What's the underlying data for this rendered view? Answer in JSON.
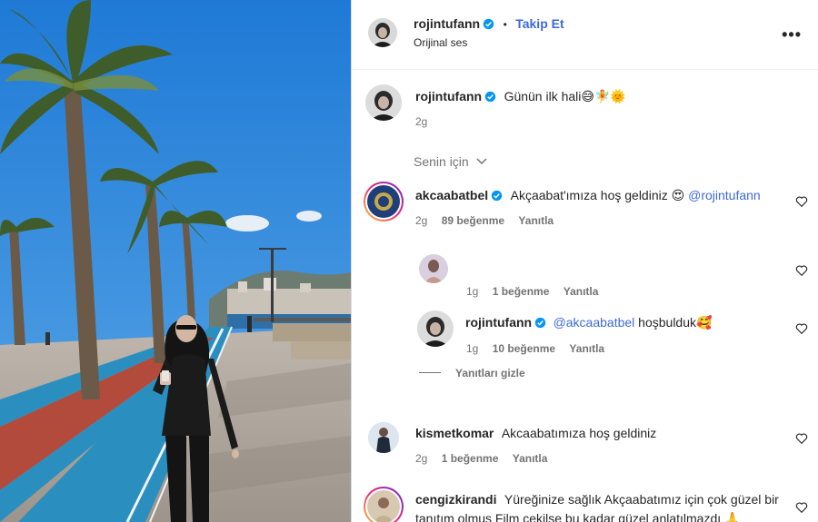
{
  "post": {
    "author": "rojintufann",
    "follow_label": "Takip Et",
    "dot": "•",
    "audio": "Orijinal ses",
    "more": "•••"
  },
  "caption": {
    "user": "rojintufann",
    "text": "Günün ilk hali😅🧚🌞",
    "time": "2g"
  },
  "sort": {
    "label": "Senin için"
  },
  "comments": [
    {
      "user": "akcaabatbel",
      "text": "Akçaabat'ımıza hoş geldiniz 😍 ",
      "mention": "@rojintufann",
      "time": "2g",
      "likes": "89 beğenme",
      "reply": "Yanıtla",
      "verified": true
    },
    {
      "user": "",
      "text": "",
      "time": "1g",
      "likes": "1 beğenme",
      "reply": "Yanıtla"
    },
    {
      "user": "rojintufann",
      "mention": "@akcaabatbel",
      "text": " hoşbulduk🥰",
      "time": "1g",
      "likes": "10 beğenme",
      "reply": "Yanıtla",
      "verified": true
    },
    {
      "user": "kismetkomar",
      "text": "Akcaabatımıza hoş geldiniz",
      "time": "2g",
      "likes": "1 beğenme",
      "reply": "Yanıtla"
    },
    {
      "user": "cengizkirandi",
      "text": "Yüreğinize sağlık Akçaabatımız için çok güzel bir",
      "text2": "tanıtım olmuş Film çekilse bu kadar güzel anlatılmazdı 🙏"
    }
  ],
  "hide_replies": "Yanıtları gizle",
  "colors": {
    "verified": "#0095f6",
    "link": "#3e6bd8",
    "muted": "#737373"
  }
}
